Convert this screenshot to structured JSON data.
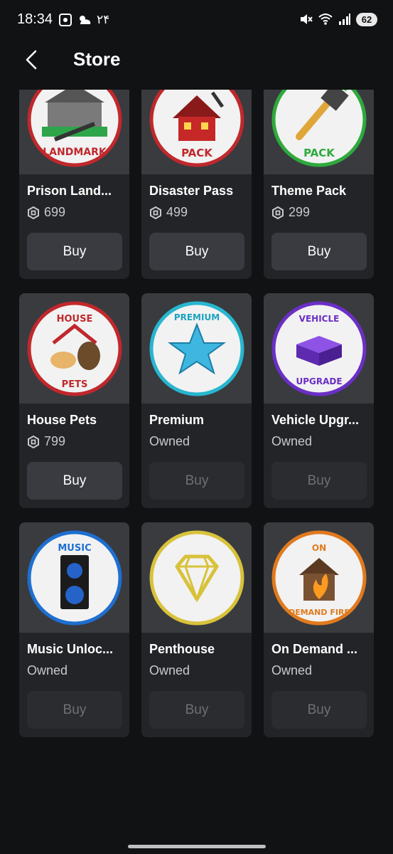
{
  "status_bar": {
    "time": "18:34",
    "temperature": "۲۴",
    "battery": "62",
    "icons": [
      "screenshot-icon",
      "weather-icon",
      "mute-icon",
      "wifi-icon",
      "signal-icon",
      "battery-icon"
    ]
  },
  "header": {
    "title": "Store",
    "back_icon": "back-chevron-icon"
  },
  "items": [
    {
      "name": "Prison Land...",
      "price": "699",
      "button": "Buy",
      "enabled": true,
      "badge_text": "LANDMARK"
    },
    {
      "name": "Disaster Pass",
      "price": "499",
      "button": "Buy",
      "enabled": true,
      "badge_text": "PACK"
    },
    {
      "name": "Theme Pack",
      "price": "299",
      "button": "Buy",
      "enabled": true,
      "badge_text": "PACK"
    },
    {
      "name": "House Pets",
      "price": "799",
      "button": "Buy",
      "enabled": true,
      "badge_text": "HOUSE PETS"
    },
    {
      "name": "Premium",
      "price": "Owned",
      "button": "Buy",
      "enabled": false,
      "badge_text": "PREMIUM"
    },
    {
      "name": "Vehicle Upgr...",
      "price": "Owned",
      "button": "Buy",
      "enabled": false,
      "badge_text": "VEHICLE UPGRADE"
    },
    {
      "name": "Music Unloc...",
      "price": "Owned",
      "button": "Buy",
      "enabled": false,
      "badge_text": "MUSIC"
    },
    {
      "name": "Penthouse",
      "price": "Owned",
      "button": "Buy",
      "enabled": false,
      "badge_text": ""
    },
    {
      "name": "On Demand ...",
      "price": "Owned",
      "button": "Buy",
      "enabled": false,
      "badge_text": "ON DEMAND FIRE"
    }
  ],
  "colors": {
    "background": "#111214",
    "card": "#232427",
    "button": "#393b40",
    "button_disabled": "#2b2c2f"
  }
}
